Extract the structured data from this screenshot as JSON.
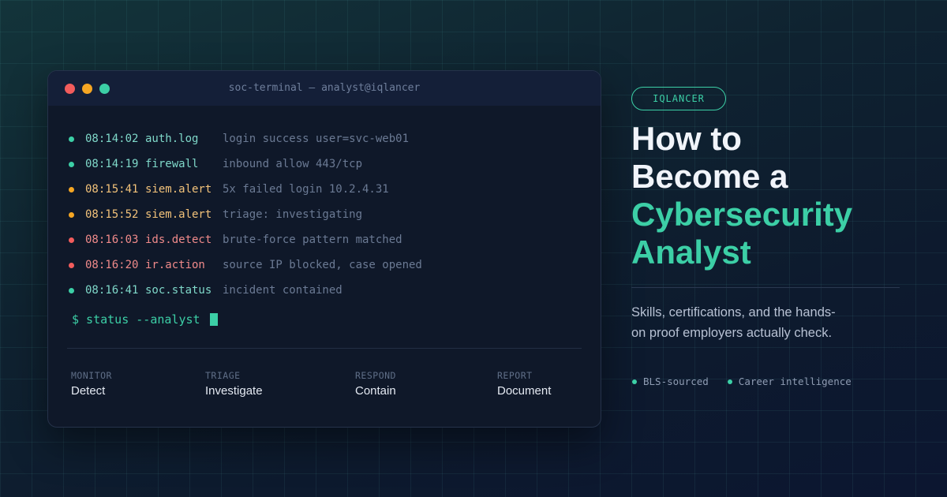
{
  "terminal": {
    "title": "soc-terminal — analyst@iqlancer",
    "log": [
      {
        "time": "08:14:02",
        "source": "auth.log",
        "message": "login success user=svc-web01",
        "level": "info"
      },
      {
        "time": "08:14:19",
        "source": "firewall",
        "message": "inbound allow 443/tcp",
        "level": "info"
      },
      {
        "time": "08:15:41",
        "source": "siem.alert",
        "message": "5x failed login 10.2.4.31",
        "level": "warn"
      },
      {
        "time": "08:15:52",
        "source": "siem.alert",
        "message": "triage: investigating",
        "level": "warn"
      },
      {
        "time": "08:16:03",
        "source": "ids.detect",
        "message": "brute-force pattern matched",
        "level": "crit"
      },
      {
        "time": "08:16:20",
        "source": "ir.action",
        "message": "source IP blocked, case opened",
        "level": "crit"
      },
      {
        "time": "08:16:41",
        "source": "soc.status",
        "message": "incident contained",
        "level": "info"
      }
    ],
    "prompt": "$ status --analyst",
    "stages": [
      {
        "label": "MONITOR",
        "value": "Detect"
      },
      {
        "label": "TRIAGE",
        "value": "Investigate"
      },
      {
        "label": "RESPOND",
        "value": "Contain"
      },
      {
        "label": "REPORT",
        "value": "Document"
      }
    ]
  },
  "badge": "IQLANCER",
  "headline": {
    "line1": "How to",
    "line2": "Become a",
    "accent_line1": "Cybersecurity",
    "accent_line2": "Analyst"
  },
  "subtitle": "Skills, certifications, and the hands-on proof employers actually check.",
  "tags": [
    "BLS-sourced",
    "Career intelligence"
  ],
  "colors": {
    "accent": "#3ccfa6",
    "info": "#3ccfa6",
    "warn": "#f5a623",
    "crit": "#f25c5c",
    "info_text": "#7fd8c9",
    "warn_text": "#f2c27a",
    "crit_text": "#f08a8a"
  },
  "icons": {
    "window_controls": [
      "close-dot-icon",
      "minimize-dot-icon",
      "maximize-dot-icon"
    ],
    "status_dot": "status-dot-icon",
    "cursor": "block-cursor-icon"
  }
}
